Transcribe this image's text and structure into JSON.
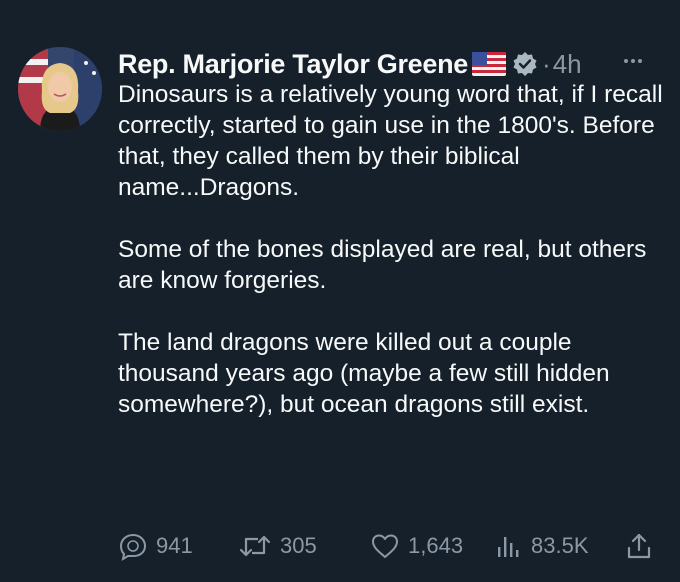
{
  "author": {
    "name": "Rep. Marjorie Taylor Greene",
    "time": "4h",
    "separator": "·"
  },
  "tweet": {
    "paragraphs": [
      "Dinosaurs is a relatively young word that, if I recall correctly, started to gain use in the 1800's. Before that, they called them by their biblical name...Dragons.",
      "Some of the bones displayed are real, but others are know forgeries.",
      "The land dragons were killed out a couple thousand years ago (maybe a few still hidden somewhere?), but ocean dragons still exist."
    ]
  },
  "actions": {
    "replies": "941",
    "retweets": "305",
    "likes": "1,643",
    "views": "83.5K"
  },
  "icons": {
    "avatar": "profile-photo",
    "flag": "us-flag-emoji",
    "verified": "verified-badge-icon",
    "more": "more-icon",
    "reply": "reply-icon",
    "retweet": "retweet-icon",
    "like": "heart-icon",
    "views": "views-icon",
    "share": "share-icon"
  },
  "colors": {
    "background": "#15202b",
    "text": "#f7f9f9",
    "muted": "#8b98a5"
  }
}
